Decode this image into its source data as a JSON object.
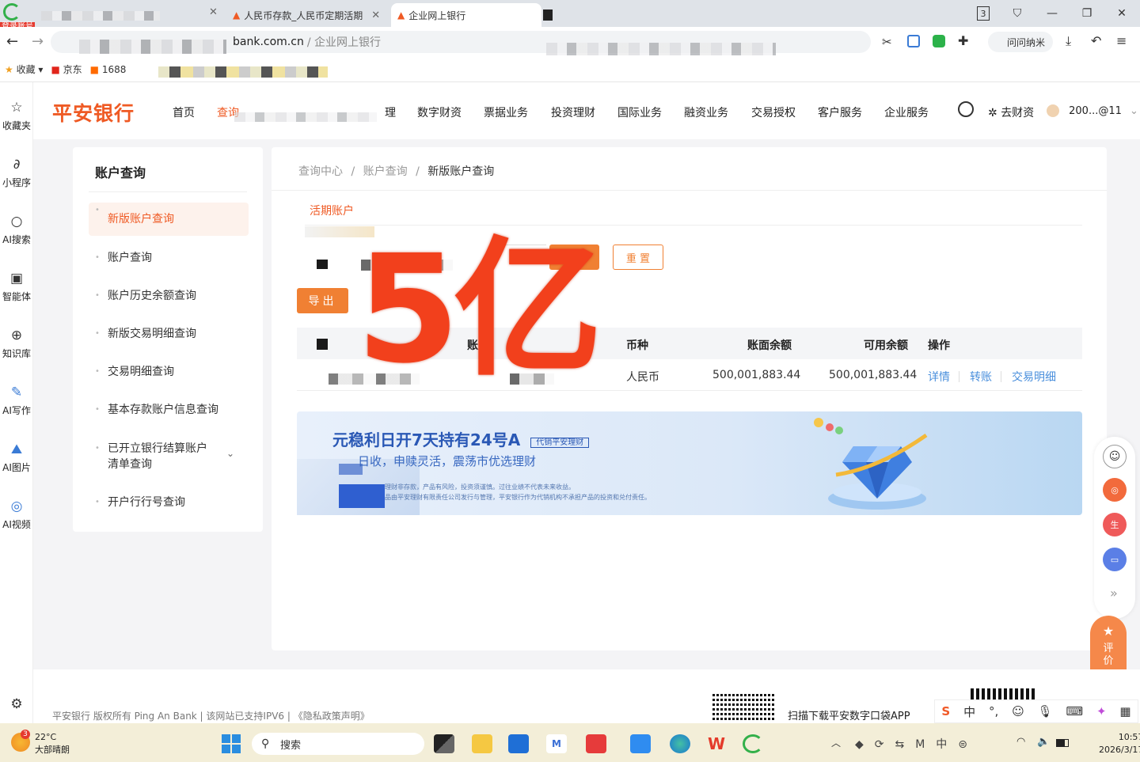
{
  "browser": {
    "login_badge": "登录账号",
    "tabs": [
      {
        "title": "人民币存款_人民币定期活期"
      },
      {
        "title": "企业网上银行"
      }
    ],
    "tab_count": "3",
    "url_host": "bank.com.cn",
    "url_title": "/ 企业网上银行",
    "bookmarks": [
      "收藏",
      "京东",
      "1688"
    ],
    "ai_button": "问问纳米"
  },
  "sidebar": {
    "items": [
      {
        "label": "收藏夹",
        "icon": "star-icon"
      },
      {
        "label": "小程序",
        "icon": "mini-program-icon"
      },
      {
        "label": "AI搜索",
        "icon": "search-icon"
      },
      {
        "label": "智能体",
        "icon": "agent-icon"
      },
      {
        "label": "知识库",
        "icon": "knowledge-icon"
      },
      {
        "label": "AI写作",
        "icon": "write-icon"
      },
      {
        "label": "AI图片",
        "icon": "image-icon"
      },
      {
        "label": "AI视频",
        "icon": "video-icon"
      }
    ]
  },
  "site": {
    "logo": "平安银行",
    "nav": [
      "首页",
      "查询",
      "数字财资",
      "票据业务",
      "投资理财",
      "国际业务",
      "融资业务",
      "交易授权",
      "客户服务",
      "企业服务"
    ],
    "nav_partial": "理",
    "go_finance": "去财资",
    "user": "200...@11"
  },
  "menu": {
    "title": "账户查询",
    "items": [
      "新版账户查询",
      "账户查询",
      "账户历史余额查询",
      "新版交易明细查询",
      "交易明细查询",
      "基本存款账户信息查询",
      "已开立银行结算账户清单查询",
      "开户行行号查询"
    ]
  },
  "main": {
    "breadcrumb": [
      "查询中心",
      "账户查询",
      "新版账户查询"
    ],
    "sep": "/",
    "subtab": "活期账户",
    "query_btn": "查 询",
    "reset_btn": "重 置",
    "export_btn": "导出",
    "table": {
      "headers": [
        "账户",
        "币种",
        "账面余额",
        "可用余额",
        "操作"
      ],
      "row": {
        "currency": "人民币",
        "book_balance": "500,001,883.44",
        "available_balance": "500,001,883.44",
        "actions": [
          "详情",
          "转账",
          "交易明细"
        ]
      }
    },
    "banner": {
      "title": "元稳利日开7天持有24号A",
      "tag": "代销平安理财",
      "subtitle": "日收，申赎灵活，震荡市优选理财",
      "note1": "理财非存款，产品有风险，投资须谨慎。过往业绩不代表未来收益。",
      "note2": "品由平安理财有限责任公司发行与管理，平安银行作为代销机构不承担产品的投资和兑付责任。"
    }
  },
  "overlay_text": "5亿",
  "right_float": {
    "rate_label": "评价",
    "expand": "»"
  },
  "footer": {
    "copyright": "平安银行 版权所有 Ping An Bank | 该网站已支持IPV6 | 《隐私政策声明》",
    "qr_caption": "扫描下载平安数字口袋APP",
    "ime": [
      "中",
      "°,",
      "☺",
      "🎤",
      "⌨"
    ]
  },
  "taskbar": {
    "weather_temp": "22°C",
    "weather_desc": "大部晴朗",
    "weather_badge": "3",
    "search_placeholder": "搜索",
    "time": "10:57",
    "date": "2026/3/17"
  },
  "colors": {
    "brand": "#ef5a24",
    "link": "#4a8fdc",
    "export": "#f08033",
    "overlay": "#f2401c"
  }
}
